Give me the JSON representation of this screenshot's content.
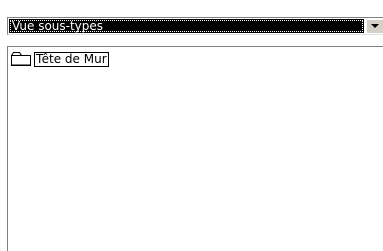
{
  "view_selector": {
    "selected": "Vue sous-types",
    "dropdown_icon": "chevron-down-icon"
  },
  "tree": {
    "items": [
      {
        "label": "Tête de Mur",
        "icon": "folder-icon"
      }
    ]
  }
}
